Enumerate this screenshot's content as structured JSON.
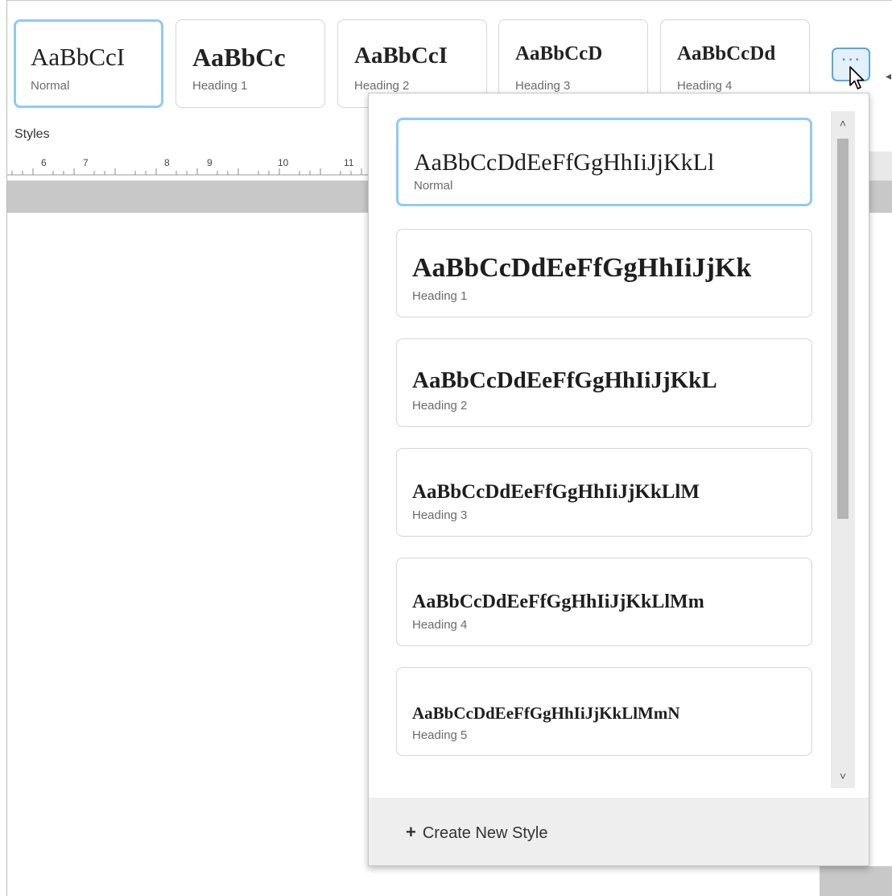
{
  "gallery": {
    "items": [
      {
        "sample": "AaBbCcI",
        "label": "Normal"
      },
      {
        "sample": "AaBbCc",
        "label": "Heading 1"
      },
      {
        "sample": "AaBbCcI",
        "label": "Heading 2"
      },
      {
        "sample": "AaBbCcD",
        "label": "Heading 3"
      },
      {
        "sample": "AaBbCcDd",
        "label": "Heading 4"
      }
    ],
    "selected": "Normal",
    "more_label": "···"
  },
  "ribbon": {
    "group_label": "Styles"
  },
  "ruler": {
    "ticks": [
      "6",
      "7",
      "8",
      "9",
      "10",
      "11"
    ]
  },
  "dropdown": {
    "items": [
      {
        "sample": "AaBbCcDdEeFfGgHhIiJjKkLl",
        "label": "Normal"
      },
      {
        "sample": "AaBbCcDdEeFfGgHhIiJjKk",
        "label": "Heading 1"
      },
      {
        "sample": "AaBbCcDdEeFfGgHhIiJjKkL",
        "label": "Heading 2"
      },
      {
        "sample": "AaBbCcDdEeFfGgHhIiJjKkLlM",
        "label": "Heading 3"
      },
      {
        "sample": "AaBbCcDdEeFfGgHhIiJjKkLlMm",
        "label": "Heading 4"
      },
      {
        "sample": "AaBbCcDdEeFfGgHhIiJjKkLlMmN",
        "label": "Heading 5"
      }
    ],
    "selected": "Normal",
    "create_label": "Create New Style"
  },
  "colors": {
    "selection_border": "#8fcbf0",
    "button_accent": "#5aa6e0",
    "ruler_band": "#c8c8c8"
  }
}
